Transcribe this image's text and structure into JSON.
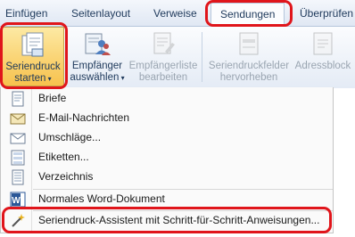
{
  "tabs": [
    "Einfügen",
    "Seitenlayout",
    "Verweise",
    "Sendungen",
    "Überprüfen"
  ],
  "ribbon": {
    "start_label_1": "Seriendruck",
    "start_label_2": "starten",
    "recipients_label_1": "Empfänger",
    "recipients_label_2": "auswählen",
    "edit_list_label_1": "Empfängerliste",
    "edit_list_label_2": "bearbeiten",
    "highlight_label_1": "Seriendruckfelder",
    "highlight_label_2": "hervorheben",
    "address_label": "Adressblock"
  },
  "menu": {
    "items": [
      {
        "label": "Briefe",
        "icon": "letter-icon"
      },
      {
        "label": "E-Mail-Nachrichten",
        "icon": "email-icon"
      },
      {
        "label": "Umschläge...",
        "icon": "envelope-icon"
      },
      {
        "label": "Etiketten...",
        "icon": "labels-icon"
      },
      {
        "label": "Verzeichnis",
        "icon": "directory-icon"
      },
      {
        "label": "Normales Word-Dokument",
        "icon": "word-document-icon"
      },
      {
        "label": "Seriendruck-Assistent mit Schritt-für-Schritt-Anweisungen...",
        "icon": "wizard-icon"
      }
    ]
  },
  "colors": {
    "highlight": "#e0151b",
    "accent": "#1e395b"
  }
}
